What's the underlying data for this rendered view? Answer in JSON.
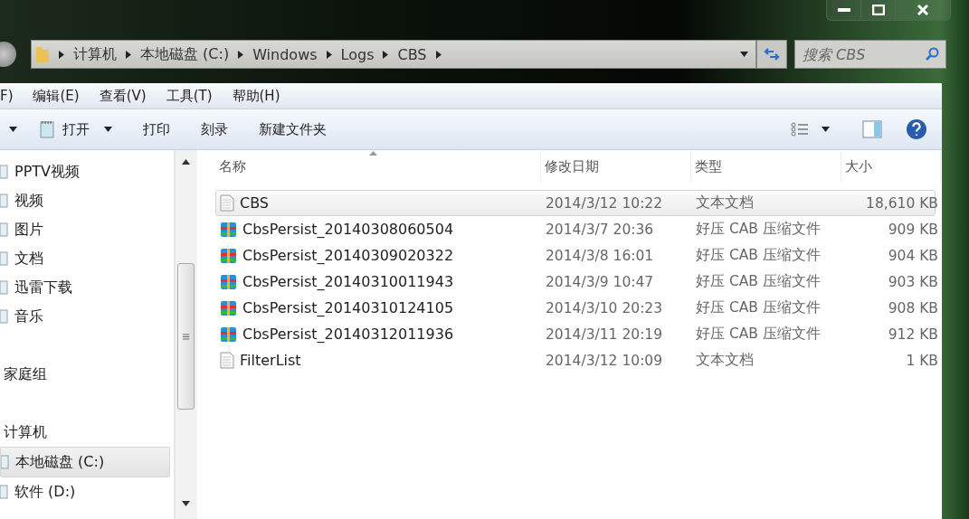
{
  "address_bar": {
    "crumbs": [
      "计算机",
      "本地磁盘 (C:)",
      "Windows",
      "Logs",
      "CBS"
    ]
  },
  "search": {
    "placeholder": "搜索 CBS"
  },
  "menu": [
    "F)",
    "编辑(E)",
    "查看(V)",
    "工具(T)",
    "帮助(H)"
  ],
  "toolbar": [
    {
      "label": "打开",
      "kind": "dropdown"
    },
    {
      "label": "打印",
      "kind": "plain"
    },
    {
      "label": "刻录",
      "kind": "plain"
    },
    {
      "label": "新建文件夹",
      "kind": "plain"
    }
  ],
  "sidebar": {
    "sections": [
      {
        "items": [
          {
            "label": "PPTV视频",
            "selected": false
          },
          {
            "label": "视频",
            "selected": false
          },
          {
            "label": "图片",
            "selected": false
          },
          {
            "label": "文档",
            "selected": false
          },
          {
            "label": "迅雷下载",
            "selected": false
          },
          {
            "label": "音乐",
            "selected": false
          }
        ]
      },
      {
        "title": "家庭组"
      },
      {
        "title": "计算机",
        "items": [
          {
            "label": "本地磁盘 (C:)",
            "selected": true
          },
          {
            "label": "软件 (D:)",
            "selected": false
          }
        ]
      }
    ]
  },
  "table": {
    "columns": [
      "名称",
      "修改日期",
      "类型",
      "大小"
    ],
    "rows": [
      {
        "kind": "text",
        "name": "CBS",
        "date": "2014/3/12 10:22",
        "type": "文本文档",
        "size": "18,610 KB",
        "selected": true
      },
      {
        "kind": "archive",
        "name": "CbsPersist_20140308060504",
        "date": "2014/3/7 20:36",
        "type": "好压 CAB 压缩文件",
        "size": "909 KB",
        "selected": false
      },
      {
        "kind": "archive",
        "name": "CbsPersist_20140309020322",
        "date": "2014/3/8 16:01",
        "type": "好压 CAB 压缩文件",
        "size": "904 KB",
        "selected": false
      },
      {
        "kind": "archive",
        "name": "CbsPersist_20140310011943",
        "date": "2014/3/9 10:47",
        "type": "好压 CAB 压缩文件",
        "size": "903 KB",
        "selected": false
      },
      {
        "kind": "archive",
        "name": "CbsPersist_20140310124105",
        "date": "2014/3/10 20:23",
        "type": "好压 CAB 压缩文件",
        "size": "908 KB",
        "selected": false
      },
      {
        "kind": "archive",
        "name": "CbsPersist_20140312011936",
        "date": "2014/3/11 20:19",
        "type": "好压 CAB 压缩文件",
        "size": "912 KB",
        "selected": false
      },
      {
        "kind": "text",
        "name": "FilterList",
        "date": "2014/3/12 10:09",
        "type": "文本文档",
        "size": "1 KB",
        "selected": false
      }
    ]
  }
}
